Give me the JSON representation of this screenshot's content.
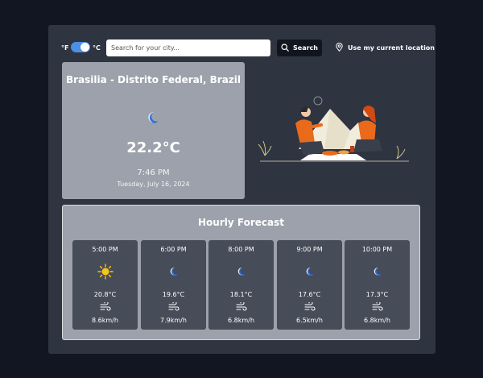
{
  "toolbar": {
    "unit_f": "°F",
    "unit_c": "°C",
    "search_placeholder": "Search for your city...",
    "search_label": "Search",
    "location_label": "Use my current location"
  },
  "current": {
    "city": "Brasilia - Distrito Federal, Brazil",
    "icon": "moon-icon",
    "temperature": "22.2°C",
    "time": "7:46 PM",
    "date": "Tuesday, July 16, 2024"
  },
  "hourly": {
    "title": "Hourly Forecast",
    "items": [
      {
        "time": "5:00 PM",
        "icon": "sun-icon",
        "temp": "20.8°C",
        "wind": "8.6km/h"
      },
      {
        "time": "6:00 PM",
        "icon": "moon-icon",
        "temp": "19.6°C",
        "wind": "7.9km/h"
      },
      {
        "time": "8:00 PM",
        "icon": "moon-icon",
        "temp": "18.1°C",
        "wind": "6.8km/h"
      },
      {
        "time": "9:00 PM",
        "icon": "moon-icon",
        "temp": "17.6°C",
        "wind": "6.5km/h"
      },
      {
        "time": "10:00 PM",
        "icon": "moon-icon",
        "temp": "17.3°C",
        "wind": "6.8km/h"
      }
    ]
  },
  "colors": {
    "background": "#111622",
    "panel": "#2e3440",
    "card": "#9ca1ab",
    "hour_card": "#464c58",
    "toggle": "#4e8fe6",
    "sun": "#f5c518",
    "moon": "#2f6fd6"
  }
}
